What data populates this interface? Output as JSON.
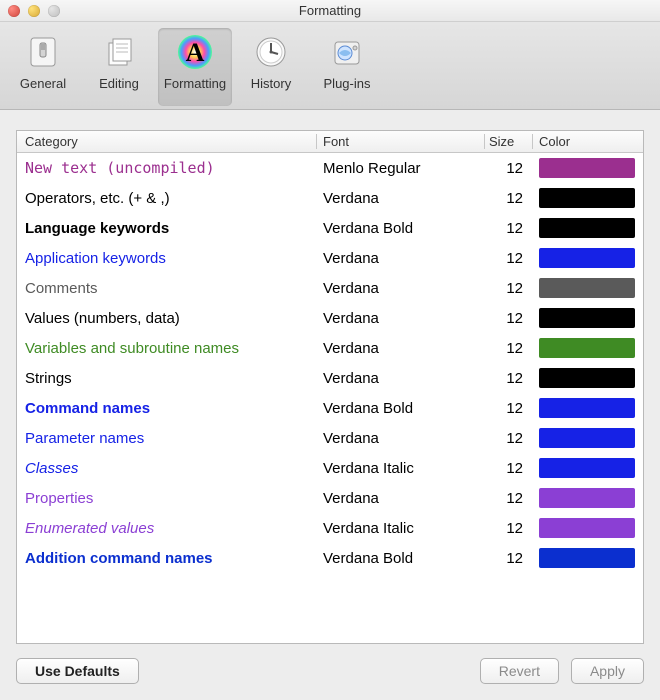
{
  "window": {
    "title": "Formatting"
  },
  "toolbar": {
    "items": [
      {
        "label": "General",
        "selected": false
      },
      {
        "label": "Editing",
        "selected": false
      },
      {
        "label": "Formatting",
        "selected": true
      },
      {
        "label": "History",
        "selected": false
      },
      {
        "label": "Plug-ins",
        "selected": false
      }
    ]
  },
  "table": {
    "headers": {
      "category": "Category",
      "font": "Font",
      "size": "Size",
      "color": "Color"
    },
    "rows": [
      {
        "category": "New text (uncompiled)",
        "font": "Menlo Regular",
        "size": "12",
        "color": "#9b2f8f",
        "bold": false,
        "italic": false,
        "fontFamily": "Menlo, monospace"
      },
      {
        "category": "Operators, etc. (+ & ,)",
        "font": "Verdana",
        "size": "12",
        "color": "#000000",
        "bold": false,
        "italic": false,
        "fontFamily": "Verdana, sans-serif"
      },
      {
        "category": "Language keywords",
        "font": "Verdana Bold",
        "size": "12",
        "color": "#000000",
        "bold": true,
        "italic": false,
        "fontFamily": "Verdana, sans-serif"
      },
      {
        "category": "Application keywords",
        "font": "Verdana",
        "size": "12",
        "color": "#1622e6",
        "bold": false,
        "italic": false,
        "fontFamily": "Verdana, sans-serif"
      },
      {
        "category": "Comments",
        "font": "Verdana",
        "size": "12",
        "color": "#5a5a5a",
        "bold": false,
        "italic": false,
        "fontFamily": "Verdana, sans-serif"
      },
      {
        "category": "Values (numbers, data)",
        "font": "Verdana",
        "size": "12",
        "color": "#000000",
        "bold": false,
        "italic": false,
        "fontFamily": "Verdana, sans-serif"
      },
      {
        "category": "Variables and subroutine names",
        "font": "Verdana",
        "size": "12",
        "color": "#3f8b24",
        "bold": false,
        "italic": false,
        "fontFamily": "Verdana, sans-serif"
      },
      {
        "category": "Strings",
        "font": "Verdana",
        "size": "12",
        "color": "#000000",
        "bold": false,
        "italic": false,
        "fontFamily": "Verdana, sans-serif"
      },
      {
        "category": "Command names",
        "font": "Verdana Bold",
        "size": "12",
        "color": "#1622e6",
        "bold": true,
        "italic": false,
        "fontFamily": "Verdana, sans-serif"
      },
      {
        "category": "Parameter names",
        "font": "Verdana",
        "size": "12",
        "color": "#1622e6",
        "bold": false,
        "italic": false,
        "fontFamily": "Verdana, sans-serif"
      },
      {
        "category": "Classes",
        "font": "Verdana Italic",
        "size": "12",
        "color": "#1622e6",
        "bold": false,
        "italic": true,
        "fontFamily": "Verdana, sans-serif"
      },
      {
        "category": "Properties",
        "font": "Verdana",
        "size": "12",
        "color": "#8b3fd4",
        "bold": false,
        "italic": false,
        "fontFamily": "Verdana, sans-serif"
      },
      {
        "category": "Enumerated values",
        "font": "Verdana Italic",
        "size": "12",
        "color": "#8b3fd4",
        "bold": false,
        "italic": true,
        "fontFamily": "Verdana, sans-serif"
      },
      {
        "category": "Addition command names",
        "font": "Verdana Bold",
        "size": "12",
        "color": "#0b2fcf",
        "bold": true,
        "italic": false,
        "fontFamily": "Verdana, sans-serif"
      }
    ]
  },
  "buttons": {
    "useDefaults": "Use Defaults",
    "revert": "Revert",
    "apply": "Apply"
  }
}
